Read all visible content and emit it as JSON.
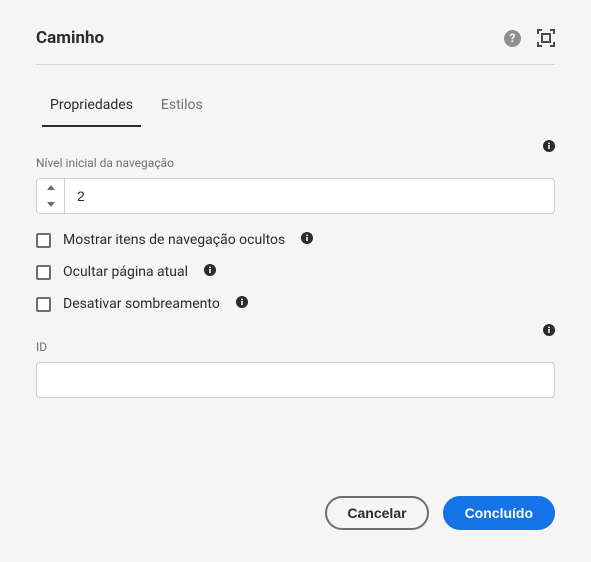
{
  "header": {
    "title": "Caminho"
  },
  "tabs": {
    "properties": "Propriedades",
    "styles": "Estilos",
    "activeIndex": 0
  },
  "fields": {
    "navStartLevel": {
      "label": "Nível inicial da navegação",
      "value": "2"
    },
    "showHidden": {
      "label": "Mostrar itens de navegação ocultos",
      "checked": false
    },
    "hideCurrent": {
      "label": "Ocultar página atual",
      "checked": false
    },
    "disableShadowing": {
      "label": "Desativar sombreamento",
      "checked": false
    },
    "id": {
      "label": "ID",
      "value": ""
    }
  },
  "footer": {
    "cancel": "Cancelar",
    "done": "Concluído"
  }
}
